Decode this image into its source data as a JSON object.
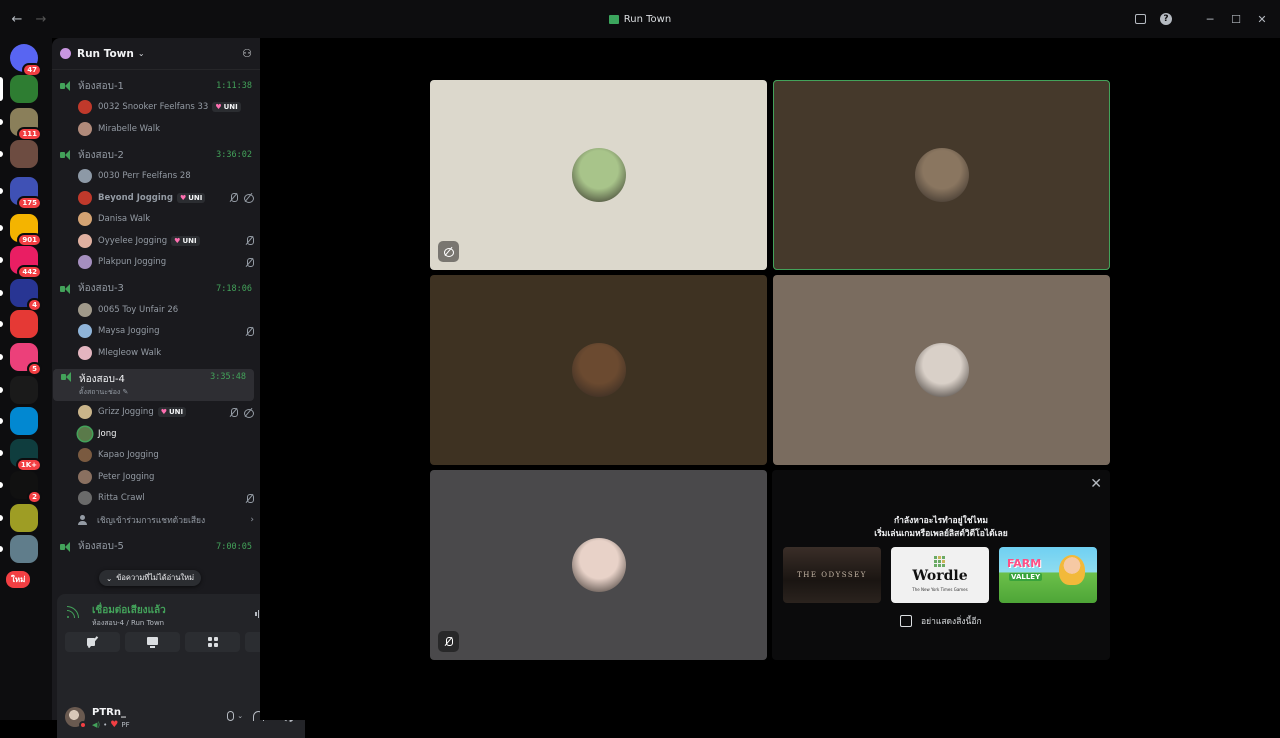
{
  "window": {
    "title": "Run Town",
    "back": "←",
    "forward": "→"
  },
  "rail": {
    "servers": [
      {
        "id": "dm",
        "badge": "47",
        "color": "#5865f2"
      },
      {
        "id": "runtown",
        "badge": "",
        "color": "#2e7d32",
        "selected": true
      },
      {
        "id": "s3",
        "badge": "111",
        "color": "#8a7f5a"
      },
      {
        "id": "s4",
        "badge": "",
        "color": "#6d4c41"
      },
      {
        "id": "s5",
        "badge": "175",
        "color": "#3f51b5"
      },
      {
        "id": "s6",
        "badge": "901",
        "color": "#f4b400"
      },
      {
        "id": "s7",
        "badge": "442",
        "color": "#e91e63"
      },
      {
        "id": "s8",
        "badge": "4",
        "color": "#283593"
      },
      {
        "id": "s9",
        "badge": "",
        "color": "#e53935"
      },
      {
        "id": "s10",
        "badge": "5",
        "color": "#ec407a"
      },
      {
        "id": "s11",
        "badge": "",
        "color": "#1a1a1a"
      },
      {
        "id": "s12",
        "badge": "",
        "color": "#0288d1"
      },
      {
        "id": "s13",
        "badge": "1K+",
        "color": "#0f3d3e"
      },
      {
        "id": "s14",
        "badge": "2",
        "color": "#111111"
      },
      {
        "id": "s15",
        "badge": "",
        "color": "#9e9d24"
      },
      {
        "id": "s16",
        "badge": "",
        "color": "#607d8b"
      }
    ],
    "new_badge": "ใหม่"
  },
  "guild": {
    "name": "Run Town"
  },
  "channels": [
    {
      "name": "ห้องสอบ-1",
      "time": "1:11:38",
      "users": [
        {
          "name": "0032 Snooker Feelfans 33",
          "tag": "UNI",
          "color": "#c0392b"
        },
        {
          "name": "Mirabelle Walk",
          "color": "#b08a7a"
        }
      ]
    },
    {
      "name": "ห้องสอบ-2",
      "time": "3:36:02",
      "users": [
        {
          "name": "0030 Perr Feelfans 28",
          "color": "#8d99a6"
        },
        {
          "name": "Beyond Jogging",
          "tag": "UNI",
          "bold": true,
          "mic_off": true,
          "cam_off": true,
          "color": "#c0392b"
        },
        {
          "name": "Danisa Walk",
          "color": "#d4a373"
        },
        {
          "name": "Oyyelee Jogging",
          "tag": "UNI",
          "mic_off": true,
          "color": "#e0b0a0"
        },
        {
          "name": "Plakpun Jogging",
          "mic_off": true,
          "color": "#a58fbf"
        }
      ]
    },
    {
      "name": "ห้องสอบ-3",
      "time": "7:18:06",
      "users": [
        {
          "name": "0065 Toy Unfair 26",
          "color": "#a0998a"
        },
        {
          "name": "Maysa Jogging",
          "mic_off": true,
          "color": "#8fb4d9"
        },
        {
          "name": "Mlegleow Walk",
          "color": "#e3b5c0"
        }
      ]
    },
    {
      "name": "ห้องสอบ-4",
      "time": "3:35:48",
      "status": "ตั้งสถานะช่อง ✎",
      "active": true,
      "users": [
        {
          "name": "Grizz Jogging",
          "tag": "UNI",
          "mic_off": true,
          "cam_off": true,
          "color": "#c9b48a"
        },
        {
          "name": "Jong",
          "white": true,
          "color": "#5a7a4a",
          "speaking": true
        },
        {
          "name": "Kapao Jogging",
          "color": "#7a5a40"
        },
        {
          "name": "Peter Jogging",
          "color": "#8a7060"
        },
        {
          "name": "Ritta Crawl",
          "mic_off": true,
          "color": "#6a6a6a"
        }
      ],
      "invite": "เชิญเข้าร่วมการแชทด้วยเสียง"
    },
    {
      "name": "ห้องสอบ-5",
      "time": "7:00:05",
      "users": []
    }
  ],
  "unread_pill": "ข้อความที่ไม่ได้อ่านใหม่",
  "voice": {
    "status": "เชื่อมต่อเสียงแล้ว",
    "location": "ห้องสอบ-4 / Run Town"
  },
  "me": {
    "name": "PTRn_",
    "sub": "PF"
  },
  "stage": {
    "tiles": [
      {
        "id": "t1",
        "bg": "#dcd8cc",
        "avatar": "#a8c48a",
        "corner": "cam"
      },
      {
        "id": "t2",
        "bg": "#45392b",
        "avatar": "#8a7660",
        "speaking": true
      },
      {
        "id": "t3",
        "bg": "#3e3222",
        "avatar": "#6b4a30"
      },
      {
        "id": "t4",
        "bg": "#7a6c5f",
        "avatar": "#d9d0c8"
      },
      {
        "id": "t5",
        "bg": "#4a494b",
        "avatar": "#e8d2c8",
        "corner": "mic"
      }
    ],
    "promo": {
      "line1": "กำลังหาอะไรทำอยู่ใช่ไหม",
      "line2": "เริ่มเล่นเกมหรือเพลย์ลิสต์วิดีโอได้เลย",
      "games": [
        {
          "title": "THE ODYSSEY"
        },
        {
          "title": "Wordle",
          "sub": "The New York Times Games"
        },
        {
          "title": "FARM",
          "sub": "VALLEY"
        }
      ],
      "checkbox_label": "อย่าแสดงสิ่งนี้อีก"
    }
  }
}
